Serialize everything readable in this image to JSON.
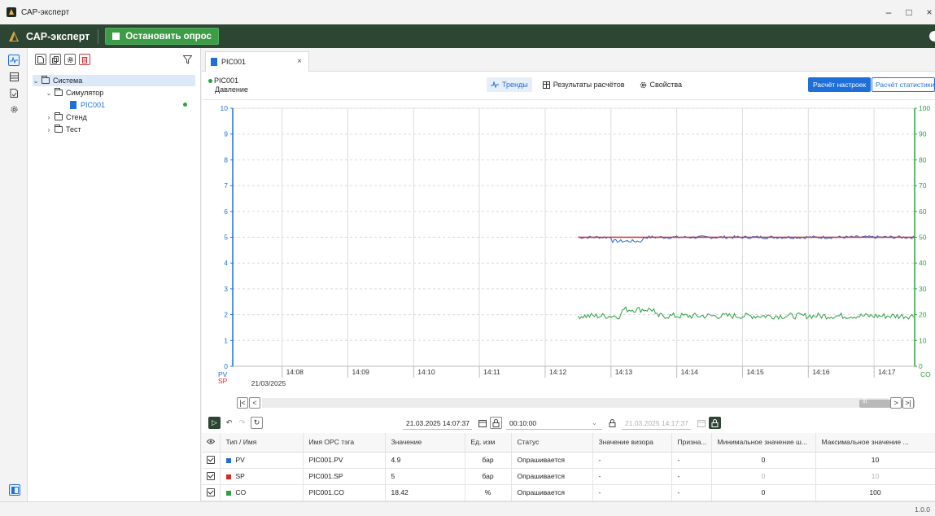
{
  "window": {
    "title": "САР-эксперт",
    "minimize": "–",
    "maximize": "□",
    "close": "×"
  },
  "appbar": {
    "name": "САР-эксперт",
    "stop_button": "Остановить опрос"
  },
  "tree": {
    "items": [
      {
        "label": "Система"
      },
      {
        "label": "Симулятор"
      },
      {
        "label": "PIC001"
      },
      {
        "label": "Стенд"
      },
      {
        "label": "Тест"
      }
    ]
  },
  "tab": {
    "label": "PIC001",
    "close": "×"
  },
  "header": {
    "tag": "PIC001",
    "description": "Давление"
  },
  "view_tabs": {
    "trends": "Тренды",
    "results": "Результаты расчётов",
    "properties": "Свойства"
  },
  "actions": {
    "tuning": "Расчёт настроек",
    "statistics": "Расчёт статистики"
  },
  "chart_data": {
    "type": "line",
    "x_labels": [
      "14:08",
      "14:09",
      "14:10",
      "14:11",
      "14:12",
      "14:13",
      "14:14",
      "14:15",
      "14:16",
      "14:17"
    ],
    "date_label": "21/03/2025",
    "left_axis": {
      "ticks": [
        "0",
        "1",
        "2",
        "3",
        "4",
        "5",
        "6",
        "7",
        "8",
        "9",
        "10"
      ],
      "ylim": [
        0,
        10
      ],
      "color": "#1e6fd8"
    },
    "right_axis": {
      "ticks": [
        "0",
        "10",
        "20",
        "30",
        "40",
        "50",
        "60",
        "70",
        "80",
        "90",
        "100"
      ],
      "ylim": [
        0,
        100
      ],
      "color": "#2ea043",
      "label": "CO"
    },
    "left_axis_labels": {
      "pv": "PV",
      "sp": "SP"
    },
    "xlim": [
      "14:07:15",
      "14:17:37"
    ],
    "series": [
      {
        "name": "PV",
        "color": "#1e6fd8",
        "axis": "left",
        "start": "14:12:30",
        "mean": 5.0,
        "noise": 0.06
      },
      {
        "name": "SP",
        "color": "#d42a2a",
        "axis": "left",
        "start": "14:12:30",
        "points": [
          [
            "14:12:30",
            5.0
          ],
          [
            "14:17:37",
            5.0
          ]
        ]
      },
      {
        "name": "CO",
        "color": "#2ea043",
        "axis": "right",
        "start": "14:12:30",
        "mean": 19.5,
        "noise": 1.2
      }
    ],
    "grid": true
  },
  "controls": {
    "start_date": "21.03.2025 14:07:37",
    "interval": "00:10:00",
    "end_date": "21.03.2025 14:17:37"
  },
  "table": {
    "columns": [
      "Тип / Имя",
      "Имя OPC тэга",
      "Значение",
      "Ед. изм",
      "Статус",
      "Значение визора",
      "Призна...",
      "Минимальное значение ш...",
      "Максимальное значение ..."
    ],
    "rows": [
      {
        "type": "PV",
        "color": "#1e6fd8",
        "opc": "PIC001.PV",
        "value": "4.9",
        "unit": "бар",
        "status": "Опрашивается",
        "visor": "-",
        "flag": "-",
        "min": "0",
        "max": "10",
        "muted": false
      },
      {
        "type": "SP",
        "color": "#d42a2a",
        "opc": "PIC001.SP",
        "value": "5",
        "unit": "бар",
        "status": "Опрашивается",
        "visor": "-",
        "flag": "-",
        "min": "0",
        "max": "10",
        "muted": true
      },
      {
        "type": "CO",
        "color": "#2ea043",
        "opc": "PIC001.CO",
        "value": "18.42",
        "unit": "%",
        "status": "Опрашивается",
        "visor": "-",
        "flag": "-",
        "min": "0",
        "max": "100",
        "muted": false
      }
    ]
  },
  "version": "1.0.0"
}
